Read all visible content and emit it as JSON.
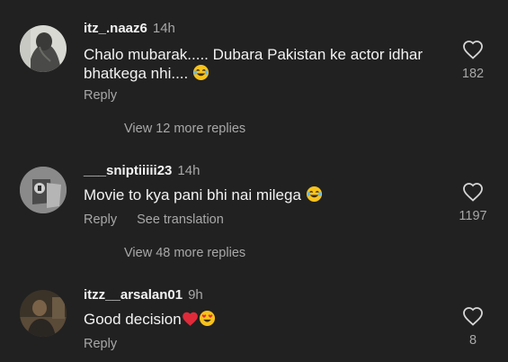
{
  "comments": [
    {
      "username": "itz_.naaz6",
      "time": "14h",
      "text": "Chalo mubarak..... Dubara Pakistan ke actor idhar bhatkega nhi....",
      "emoji": "laughing-tears",
      "reply_label": "Reply",
      "likes": "182",
      "view_replies": "View 12 more replies"
    },
    {
      "username": "___sniptiiiii23",
      "time": "14h",
      "text": "Movie to kya pani bhi nai milega",
      "emoji": "laughing-tears",
      "reply_label": "Reply",
      "translate_label": "See translation",
      "likes": "1197",
      "view_replies": "View 48 more replies"
    },
    {
      "username": "itzz__arsalan01",
      "time": "9h",
      "text": "Good decision",
      "emoji": "red-heart heart-eyes",
      "reply_label": "Reply",
      "likes": "8"
    }
  ],
  "colors": {
    "background": "#212121",
    "primary_text": "#f2f2f2",
    "secondary_text": "#a8a8a8",
    "heart": "#e02a3a",
    "emoji_yellow": "#f7c21b"
  }
}
